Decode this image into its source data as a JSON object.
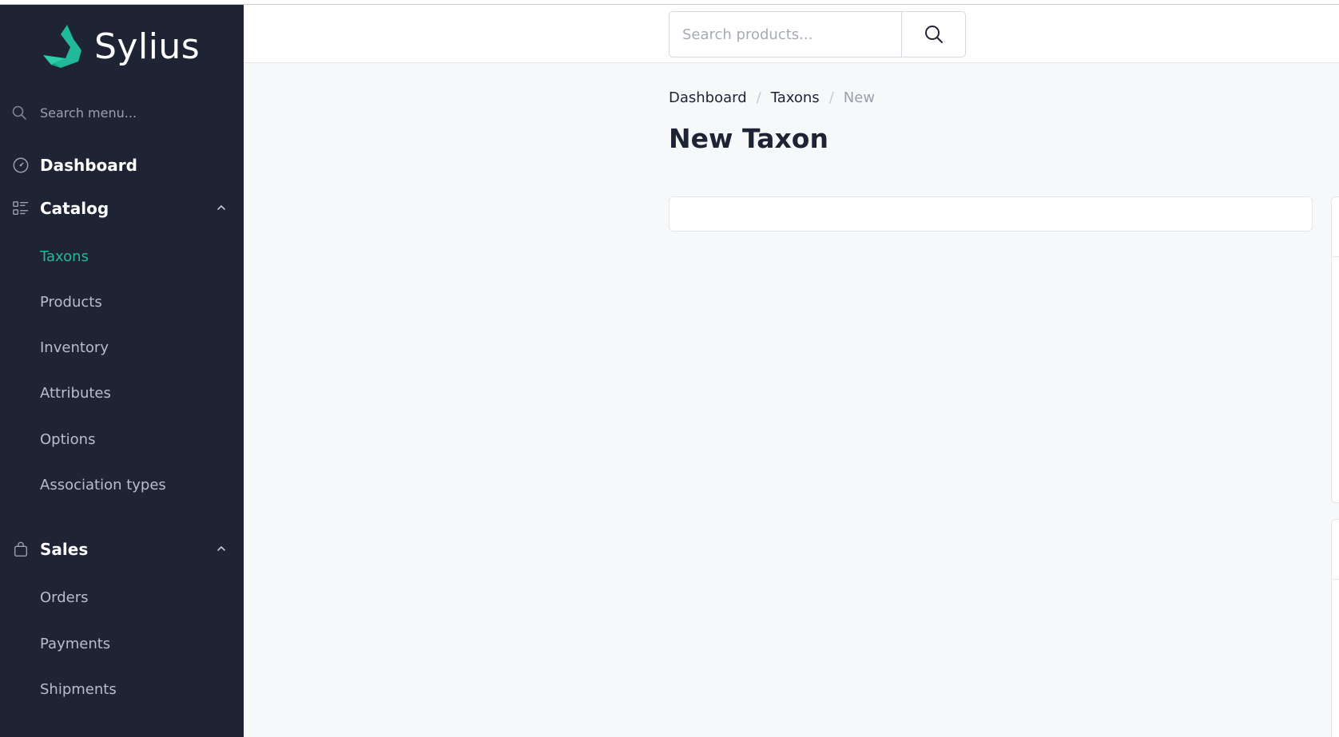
{
  "brand": {
    "name": "Sylius"
  },
  "sidebar": {
    "search_placeholder": "Search menu...",
    "dashboard_label": "Dashboard",
    "catalog": {
      "label": "Catalog",
      "items": [
        "Taxons",
        "Products",
        "Inventory",
        "Attributes",
        "Options",
        "Association types"
      ],
      "active": "Taxons"
    },
    "sales": {
      "label": "Sales",
      "items": [
        "Orders",
        "Payments",
        "Shipments"
      ]
    }
  },
  "topbar": {
    "search_placeholder": "Search products..."
  },
  "breadcrumb": {
    "items": [
      "Dashboard",
      "Taxons"
    ],
    "current": "New"
  },
  "page": {
    "title": "New Taxon"
  },
  "colors": {
    "sidebar_bg": "#1f2435",
    "accent": "#22b99a",
    "page_bg": "#f6f8fa"
  }
}
